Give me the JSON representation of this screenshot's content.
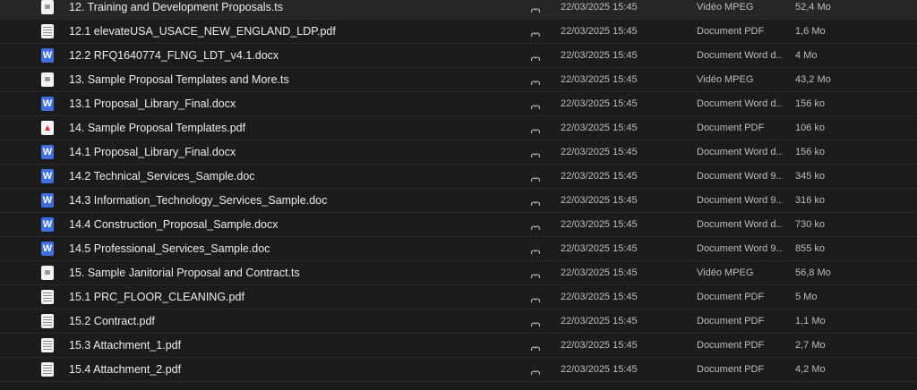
{
  "files": [
    {
      "name": "12. Training and Development Proposals.ts",
      "icon": "video-file-icon",
      "date": "22/03/2025 15:45",
      "type": "Vidéo MPEG",
      "size": "52,4 Mo"
    },
    {
      "name": "12.1 elevateUSA_USACE_NEW_ENGLAND_LDP.pdf",
      "icon": "pdf-file-icon",
      "date": "22/03/2025 15:45",
      "type": "Document PDF",
      "size": "1,6 Mo"
    },
    {
      "name": "12.2 RFQ1640774_FLNG_LDT_v4.1.docx",
      "icon": "word-file-icon",
      "date": "22/03/2025 15:45",
      "type": "Document Word d...",
      "size": "4 Mo"
    },
    {
      "name": "13. Sample Proposal Templates and More.ts",
      "icon": "video-file-icon",
      "date": "22/03/2025 15:45",
      "type": "Vidéo MPEG",
      "size": "43,2 Mo"
    },
    {
      "name": "13.1 Proposal_Library_Final.docx",
      "icon": "word-file-icon",
      "date": "22/03/2025 15:45",
      "type": "Document Word d...",
      "size": "156 ko"
    },
    {
      "name": "14. Sample Proposal Templates.pdf",
      "icon": "pdf-red-file-icon",
      "date": "22/03/2025 15:45",
      "type": "Document PDF",
      "size": "106 ko"
    },
    {
      "name": "14.1 Proposal_Library_Final.docx",
      "icon": "word-file-icon",
      "date": "22/03/2025 15:45",
      "type": "Document Word d...",
      "size": "156 ko"
    },
    {
      "name": "14.2 Technical_Services_Sample.doc",
      "icon": "word-file-icon",
      "date": "22/03/2025 15:45",
      "type": "Document Word 9...",
      "size": "345 ko"
    },
    {
      "name": "14.3 Information_Technology_Services_Sample.doc",
      "icon": "word-file-icon",
      "date": "22/03/2025 15:45",
      "type": "Document Word 9...",
      "size": "316 ko"
    },
    {
      "name": "14.4 Construction_Proposal_Sample.docx",
      "icon": "word-file-icon",
      "date": "22/03/2025 15:45",
      "type": "Document Word d...",
      "size": "730 ko"
    },
    {
      "name": "14.5 Professional_Services_Sample.doc",
      "icon": "word-file-icon",
      "date": "22/03/2025 15:45",
      "type": "Document Word 9...",
      "size": "855 ko"
    },
    {
      "name": "15. Sample Janitorial Proposal and Contract.ts",
      "icon": "video-file-icon",
      "date": "22/03/2025 15:45",
      "type": "Vidéo MPEG",
      "size": "56,8 Mo"
    },
    {
      "name": "15.1 PRC_FLOOR_CLEANING.pdf",
      "icon": "pdf-file-icon",
      "date": "22/03/2025 15:45",
      "type": "Document PDF",
      "size": "5 Mo"
    },
    {
      "name": "15.2 Contract.pdf",
      "icon": "pdf-file-icon",
      "date": "22/03/2025 15:45",
      "type": "Document PDF",
      "size": "1,1 Mo"
    },
    {
      "name": "15.3 Attachment_1.pdf",
      "icon": "pdf-file-icon",
      "date": "22/03/2025 15:45",
      "type": "Document PDF",
      "size": "2,7 Mo"
    },
    {
      "name": "15.4 Attachment_2.pdf",
      "icon": "pdf-file-icon",
      "date": "22/03/2025 15:45",
      "type": "Document PDF",
      "size": "4,2 Mo"
    }
  ]
}
